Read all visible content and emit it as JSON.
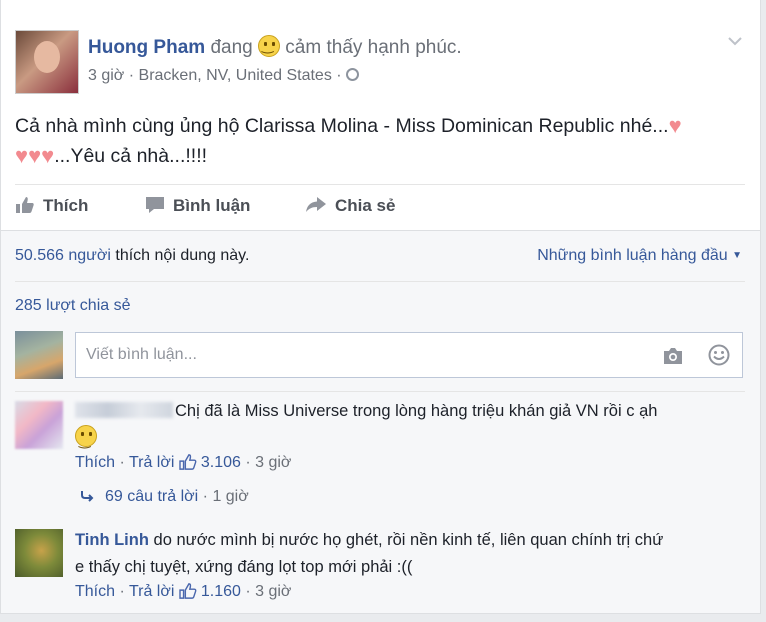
{
  "post": {
    "author": "Huong Pham",
    "status_prefix": "đang",
    "status_feeling": "cảm thấy hạnh phúc.",
    "time": "3 giờ",
    "location": "Bracken, NV, United States",
    "sep": "·",
    "text_line1": "Cả nhà mình cùng ủng hộ Clarissa Molina - Miss Dominican Republic nhé...",
    "text_line2": "...Yêu cả nhà...!!!!"
  },
  "actions": {
    "like": "Thích",
    "comment": "Bình luận",
    "share": "Chia sẻ"
  },
  "stats": {
    "like_count": "50.566 người",
    "like_suffix": "thích nội dung này.",
    "top_comments": "Những bình luận hàng đầu",
    "shares": "285 lượt chia sẻ"
  },
  "composer": {
    "placeholder": "Viết bình luận..."
  },
  "comments": [
    {
      "name": "",
      "text_line1": "Chị đã là Miss Universe trong lòng hàng triệu khán giả VN rồi c ạh",
      "like": "Thích",
      "reply": "Trả lời",
      "likes": "3.106",
      "time": "3 giờ",
      "replies_label": "69 câu trả lời",
      "replies_time": "1 giờ"
    },
    {
      "name": "Tinh Linh",
      "text_line1": "do nước mình bị nước họ ghét, rồi nền kinh tế, liên quan chính trị chứ",
      "text_line2": "e thấy chị tuyệt, xứng đáng lọt top mới phải :((",
      "like": "Thích",
      "reply": "Trả lời",
      "likes": "1.160",
      "time": "3 giờ"
    }
  ],
  "colors": {
    "link": "#365899",
    "meta": "#6a6f77",
    "heart": "#f28a8f"
  }
}
